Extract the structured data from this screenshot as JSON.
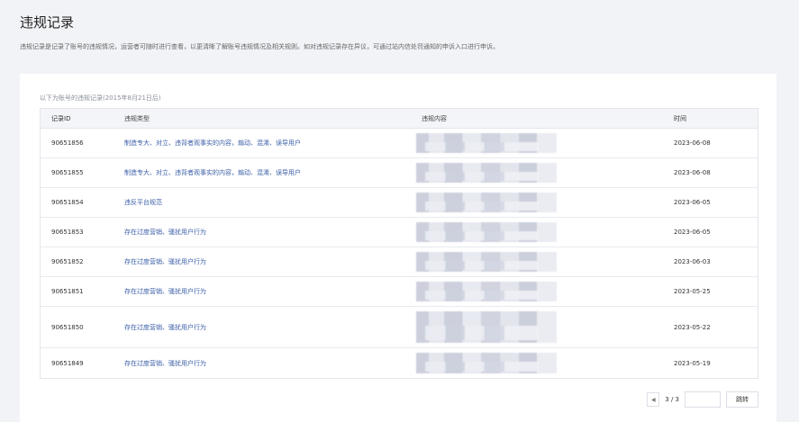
{
  "page": {
    "title": "违规记录",
    "description": "违规记录是记录了账号的违规情况，运营者可随时进行查看，以更清晰了解账号违规情况及相关规则。如对违规记录存在异议，可通过站内信处罚通知的申诉入口进行申诉。"
  },
  "table": {
    "caption": "以下为账号的违规记录(2015年8月21日后)",
    "headers": {
      "id": "记录ID",
      "type": "违规类型",
      "content": "违规内容",
      "time": "时间"
    },
    "rows": [
      {
        "id": "90651856",
        "type": "制造专大、对立、违背者观事实的内容，煽动、混淆、误导用户",
        "time": "2023-06-08"
      },
      {
        "id": "90651855",
        "type": "制造专大、对立、违背者观事实的内容，煽动、混淆、误导用户",
        "time": "2023-06-08"
      },
      {
        "id": "90651854",
        "type": "违反平台规范",
        "time": "2023-06-05"
      },
      {
        "id": "90651853",
        "type": "存在过度营销、骚扰用户行为",
        "time": "2023-06-05"
      },
      {
        "id": "90651852",
        "type": "存在过度营销、骚扰用户行为",
        "time": "2023-06-03"
      },
      {
        "id": "90651851",
        "type": "存在过度营销、骚扰用户行为",
        "time": "2023-05-25"
      },
      {
        "id": "90651850",
        "type": "存在过度营销、骚扰用户行为",
        "time": "2023-05-22"
      },
      {
        "id": "90651849",
        "type": "存在过度营销、骚扰用户行为",
        "time": "2023-05-19"
      }
    ]
  },
  "pager": {
    "prev_icon": "chevron-left-icon",
    "page_info": "3 / 3",
    "go_label": "跳转"
  }
}
